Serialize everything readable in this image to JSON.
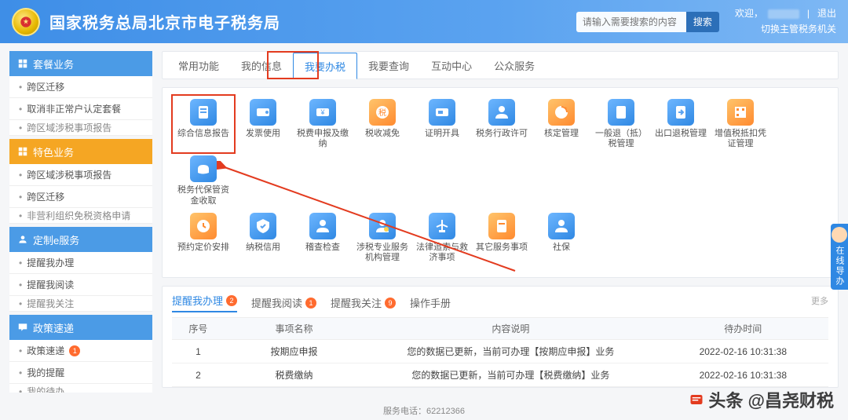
{
  "header": {
    "title": "国家税务总局北京市电子税务局",
    "search_placeholder": "请输入需要搜索的内容",
    "search_btn": "搜索",
    "welcome": "欢迎，",
    "logout": "退出",
    "switch_org": "切换主管税务机关"
  },
  "sidebar": {
    "sections": [
      {
        "title": "套餐业务",
        "items": [
          "跨区迁移",
          "取消非正常户认定套餐",
          "跨区域涉税事项报告"
        ]
      },
      {
        "title": "特色业务",
        "items": [
          "跨区域涉税事项报告",
          "跨区迁移",
          "非营利组织免税资格申请"
        ]
      },
      {
        "title": "定制e服务",
        "items": [
          "提醒我办理",
          "提醒我阅读",
          "提醒我关注"
        ]
      },
      {
        "title": "政策速递",
        "items": [
          {
            "label": "政策速递",
            "badge": "1"
          },
          {
            "label": "我的提醒"
          },
          {
            "label": "我的待办"
          }
        ]
      }
    ]
  },
  "tabs": {
    "items": [
      "常用功能",
      "我的信息",
      "我要办税",
      "我要查询",
      "互动中心",
      "公众服务"
    ],
    "active_index": 2
  },
  "functions": {
    "row1": [
      {
        "id": "zhxxbg",
        "label": "综合信息报告"
      },
      {
        "id": "fpsy",
        "label": "发票使用"
      },
      {
        "id": "sfsbjj",
        "label": "税费申报及缴纳"
      },
      {
        "id": "sqjm",
        "label": "税收减免"
      },
      {
        "id": "zmkj",
        "label": "证明开具"
      },
      {
        "id": "swxzxk",
        "label": "税务行政许可"
      },
      {
        "id": "hdgl",
        "label": "核定管理"
      },
      {
        "id": "ybtds",
        "label": "一般退（抵）税管理"
      },
      {
        "id": "cktsgl",
        "label": "出口退税管理"
      },
      {
        "id": "zzsdkpz",
        "label": "增值税抵扣凭证管理"
      },
      {
        "id": "swdbgzj",
        "label": "税务代保管资金收取"
      }
    ],
    "row2": [
      {
        "id": "yydjap",
        "label": "预约定价安排"
      },
      {
        "id": "nsxy",
        "label": "纳税信用"
      },
      {
        "id": "jcjc",
        "label": "稽查检查"
      },
      {
        "id": "sszyfwjg",
        "label": "涉税专业服务机构管理"
      },
      {
        "id": "flzsjj",
        "label": "法律追索与救济事项"
      },
      {
        "id": "qtfwsx",
        "label": "其它服务事项"
      },
      {
        "id": "sb",
        "label": "社保"
      }
    ]
  },
  "reminder": {
    "tabs": [
      {
        "label": "提醒我办理",
        "badge": "2"
      },
      {
        "label": "提醒我阅读",
        "badge": "1"
      },
      {
        "label": "提醒我关注",
        "badge": "9"
      },
      {
        "label": "操作手册"
      }
    ],
    "more": "更多",
    "columns": [
      "序号",
      "事项名称",
      "内容说明",
      "待办时间"
    ],
    "rows": [
      {
        "no": "1",
        "name": "按期应申报",
        "desc": "您的数据已更新，当前可办理【按期应申报】业务",
        "time": "2022-02-16 10:31:38"
      },
      {
        "no": "2",
        "name": "税费缴纳",
        "desc": "您的数据已更新，当前可办理【税费缴纳】业务",
        "time": "2022-02-16 10:31:38"
      }
    ]
  },
  "footer": {
    "hotline": "服务电话：62212366"
  },
  "float_assist": "在线导办",
  "watermark": "头条 @昌尧财税"
}
